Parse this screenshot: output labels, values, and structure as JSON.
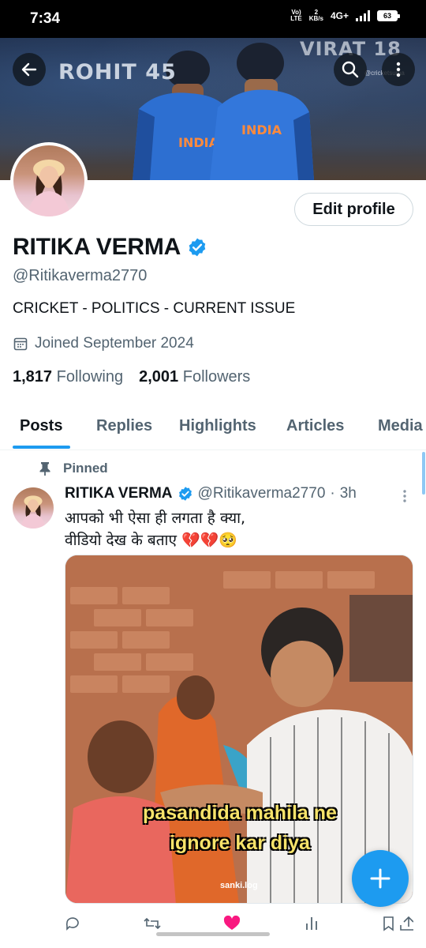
{
  "status_bar": {
    "time": "7:34",
    "volte_line1": "Vo)",
    "volte_line2": "LTE",
    "speed_value": "2",
    "speed_unit": "KB/s",
    "network": "4G+",
    "battery": "63"
  },
  "banner": {
    "left_text": "ROHIT 45",
    "right_text": "VIRAT 18",
    "watermark": "@cricketsuma"
  },
  "profile": {
    "display_name": "RITIKA VERMA",
    "handle": "@Ritikaverma2770",
    "bio": "CRICKET - POLITICS - CURRENT ISSUE",
    "joined": "Joined September 2024",
    "following_count": "1,817",
    "following_label": "Following",
    "followers_count": "2,001",
    "followers_label": "Followers",
    "edit_label": "Edit profile",
    "verified": true
  },
  "tabs": [
    {
      "label": "Posts",
      "active": true
    },
    {
      "label": "Replies",
      "active": false
    },
    {
      "label": "Highlights",
      "active": false
    },
    {
      "label": "Articles",
      "active": false
    },
    {
      "label": "Media",
      "active": false
    }
  ],
  "post": {
    "pinned_label": "Pinned",
    "author_name": "RITIKA VERMA",
    "author_handle": "@Ritikaverma2770",
    "separator": "·",
    "time_ago": "3h",
    "text_line1": "आपको भी ऐसा ही लगता है क्या,",
    "text_line2": "वीडियो देख के बताए 💔💔🥺",
    "media_caption_line1": "pasandida mahila ne",
    "media_caption_line2": "ignore kar diya",
    "media_watermark": "sanki.log"
  },
  "colors": {
    "accent": "#1d9bf0",
    "secondary_text": "#536471",
    "like": "#f91880"
  },
  "icons": {
    "back": "arrow-left-icon",
    "search": "search-icon",
    "more": "more-vertical-icon",
    "verified": "verified-badge-icon",
    "calendar": "calendar-icon",
    "pin": "pin-icon",
    "compose": "plus-icon"
  }
}
